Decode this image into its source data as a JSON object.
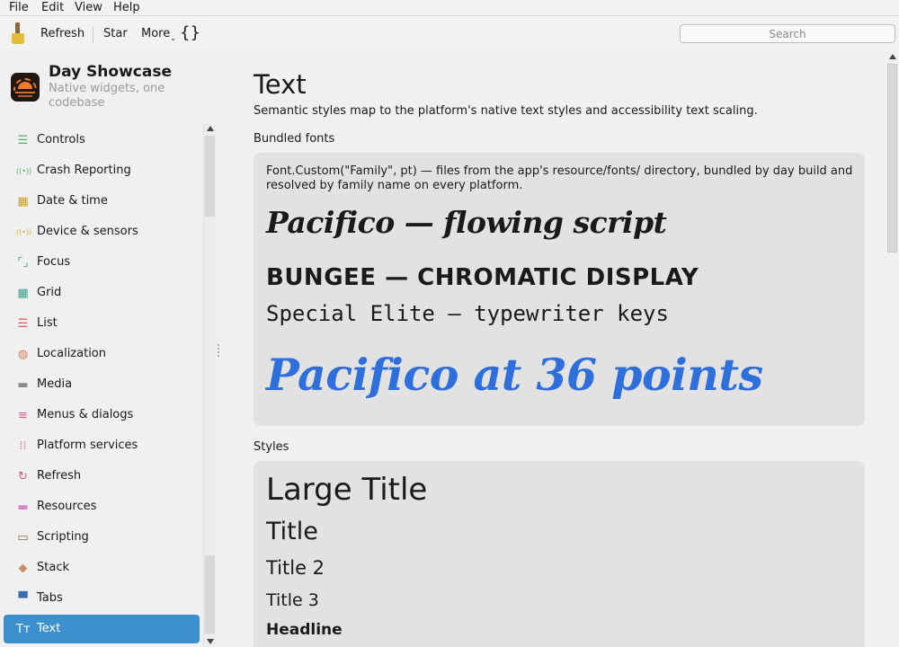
{
  "menubar": {
    "file": "File",
    "edit": "Edit",
    "view": "View",
    "help": "Help"
  },
  "toolbar": {
    "refresh": "Refresh",
    "star": "Star",
    "more": "More",
    "braces": "{}",
    "search_placeholder": "Search"
  },
  "app": {
    "title": "Day Showcase",
    "subtitle": "Native widgets, one codebase"
  },
  "nav": [
    {
      "label": "Controls",
      "icon": "sliders-icon",
      "glyph": "☰",
      "color": "#4caf6a"
    },
    {
      "label": "Crash Reporting",
      "icon": "broadcast-icon",
      "glyph": "((•))",
      "color": "#4caf6a"
    },
    {
      "label": "Date & time",
      "icon": "calendar-icon",
      "glyph": "▦",
      "color": "#c9a227"
    },
    {
      "label": "Device & sensors",
      "icon": "sensor-icon",
      "glyph": "((•))",
      "color": "#e0a83a"
    },
    {
      "label": "Focus",
      "icon": "focus-icon",
      "glyph": "⌜⌟",
      "color": "#3aa0a0"
    },
    {
      "label": "Grid",
      "icon": "grid-icon",
      "glyph": "▦",
      "color": "#3aa08a"
    },
    {
      "label": "List",
      "icon": "list-icon",
      "glyph": "☰",
      "color": "#e05555"
    },
    {
      "label": "Localization",
      "icon": "globe-icon",
      "glyph": "◍",
      "color": "#e07a5a"
    },
    {
      "label": "Media",
      "icon": "film-icon",
      "glyph": "▬",
      "color": "#8a8a8a"
    },
    {
      "label": "Menus & dialogs",
      "icon": "menu-icon",
      "glyph": "≡",
      "color": "#d65a7a"
    },
    {
      "label": "Platform services",
      "icon": "dots-grid-icon",
      "glyph": "⁞⁞",
      "color": "#d088a8"
    },
    {
      "label": "Refresh",
      "icon": "refresh-icon",
      "glyph": "↻",
      "color": "#d05a7a"
    },
    {
      "label": "Resources",
      "icon": "folder-icon",
      "glyph": "▬",
      "color": "#d088c0"
    },
    {
      "label": "Scripting",
      "icon": "terminal-icon",
      "glyph": "▭",
      "color": "#8a6a4a"
    },
    {
      "label": "Stack",
      "icon": "layers-icon",
      "glyph": "◆",
      "color": "#c8906a"
    },
    {
      "label": "Tabs",
      "icon": "tabs-icon",
      "glyph": "▀",
      "color": "#3a6aa8"
    },
    {
      "label": "Text",
      "icon": "text-size-icon",
      "glyph": "Tт",
      "color": "#ffffff",
      "active": true
    }
  ],
  "page": {
    "title": "Text",
    "description": "Semantic styles map to the platform's native text styles and accessibility text scaling.",
    "bundled_heading": "Bundled fonts",
    "bundled_desc": "Font.Custom(\"Family\", pt) — files from the app's resource/fonts/ directory, bundled by day build and resolved by family name on every platform.",
    "pacifico": "Pacifico — flowing script",
    "bungee": "BUNGEE — CHROMATIC DISPLAY",
    "elite": "Special Elite — typewriter keys",
    "pacifico36": "Pacifico at 36 points",
    "accent_color": "#2f6fdc",
    "styles_heading": "Styles",
    "styles": [
      "Large Title",
      "Title",
      "Title 2",
      "Title 3",
      "Headline"
    ]
  }
}
